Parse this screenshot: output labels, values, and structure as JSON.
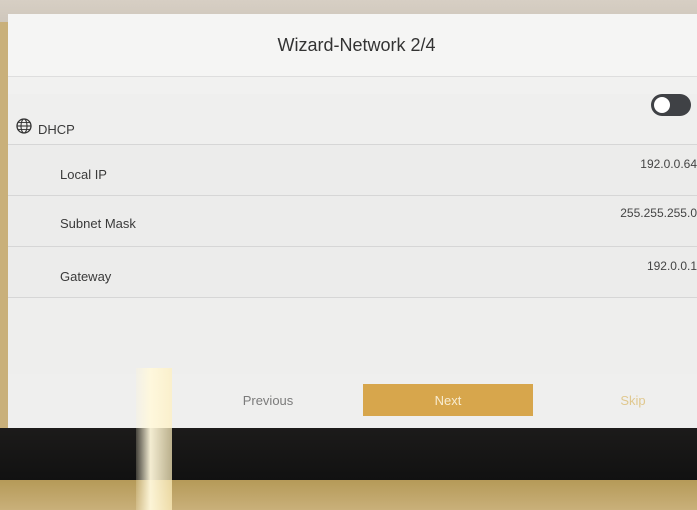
{
  "header": {
    "title": "Wizard-Network 2/4"
  },
  "network": {
    "dhcp": {
      "label": "DHCP",
      "icon": "globe-icon",
      "enabled": false
    },
    "local_ip": {
      "label": "Local IP",
      "value": "192.0.0.64"
    },
    "subnet_mask": {
      "label": "Subnet Mask",
      "value": "255.255.255.0"
    },
    "gateway": {
      "label": "Gateway",
      "value": "192.0.0.1"
    }
  },
  "footer": {
    "previous_label": "Previous",
    "next_label": "Next",
    "skip_label": "Skip"
  },
  "colors": {
    "accent": "#d7a64c",
    "toggle_off": "#3f4145"
  }
}
